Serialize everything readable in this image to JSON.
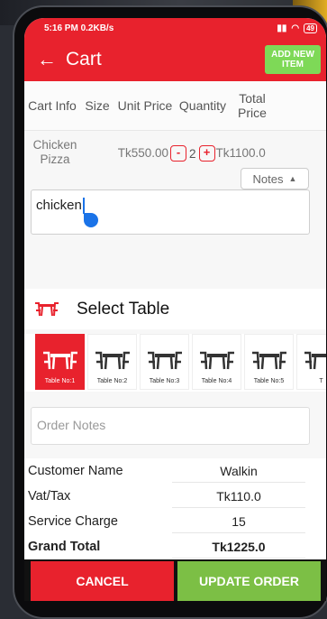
{
  "status_bar": {
    "time_speed": "5:16 PM  0.2KB/s",
    "battery": "49"
  },
  "header": {
    "title": "Cart",
    "back_icon": "arrow-left",
    "add_button": "ADD NEW\nITEM"
  },
  "cart_table": {
    "columns": [
      "Cart Info",
      "Size",
      "Unit Price",
      "Quantity",
      "Total\nPrice"
    ],
    "items": [
      {
        "name": "Chicken\nPizza",
        "size": "",
        "unit_price": "Tk550.00",
        "minus": "-",
        "quantity": "2",
        "plus": "+",
        "total": "Tk1100.0"
      }
    ]
  },
  "notes": {
    "label": "Notes",
    "value": "chicken"
  },
  "select_table": {
    "title": "Select Table",
    "tables": [
      {
        "label": "Table No:1",
        "selected": true
      },
      {
        "label": "Table No:2",
        "selected": false
      },
      {
        "label": "Table No:3",
        "selected": false
      },
      {
        "label": "Table No:4",
        "selected": false
      },
      {
        "label": "Table No:5",
        "selected": false
      },
      {
        "label": "T",
        "selected": false
      }
    ]
  },
  "order_notes": {
    "placeholder": "Order Notes"
  },
  "summary": {
    "rows": [
      {
        "label": "Customer Name",
        "value": "Walkin"
      },
      {
        "label": "Vat/Tax",
        "value": "Tk110.0"
      },
      {
        "label": "Service Charge",
        "value": "15"
      },
      {
        "label": "Grand Total",
        "value": "Tk1225.0"
      }
    ]
  },
  "footer": {
    "cancel": "CANCEL",
    "update": "UPDATE ORDER"
  },
  "colors": {
    "primary_red": "#e8222d",
    "primary_green": "#7ed957"
  }
}
